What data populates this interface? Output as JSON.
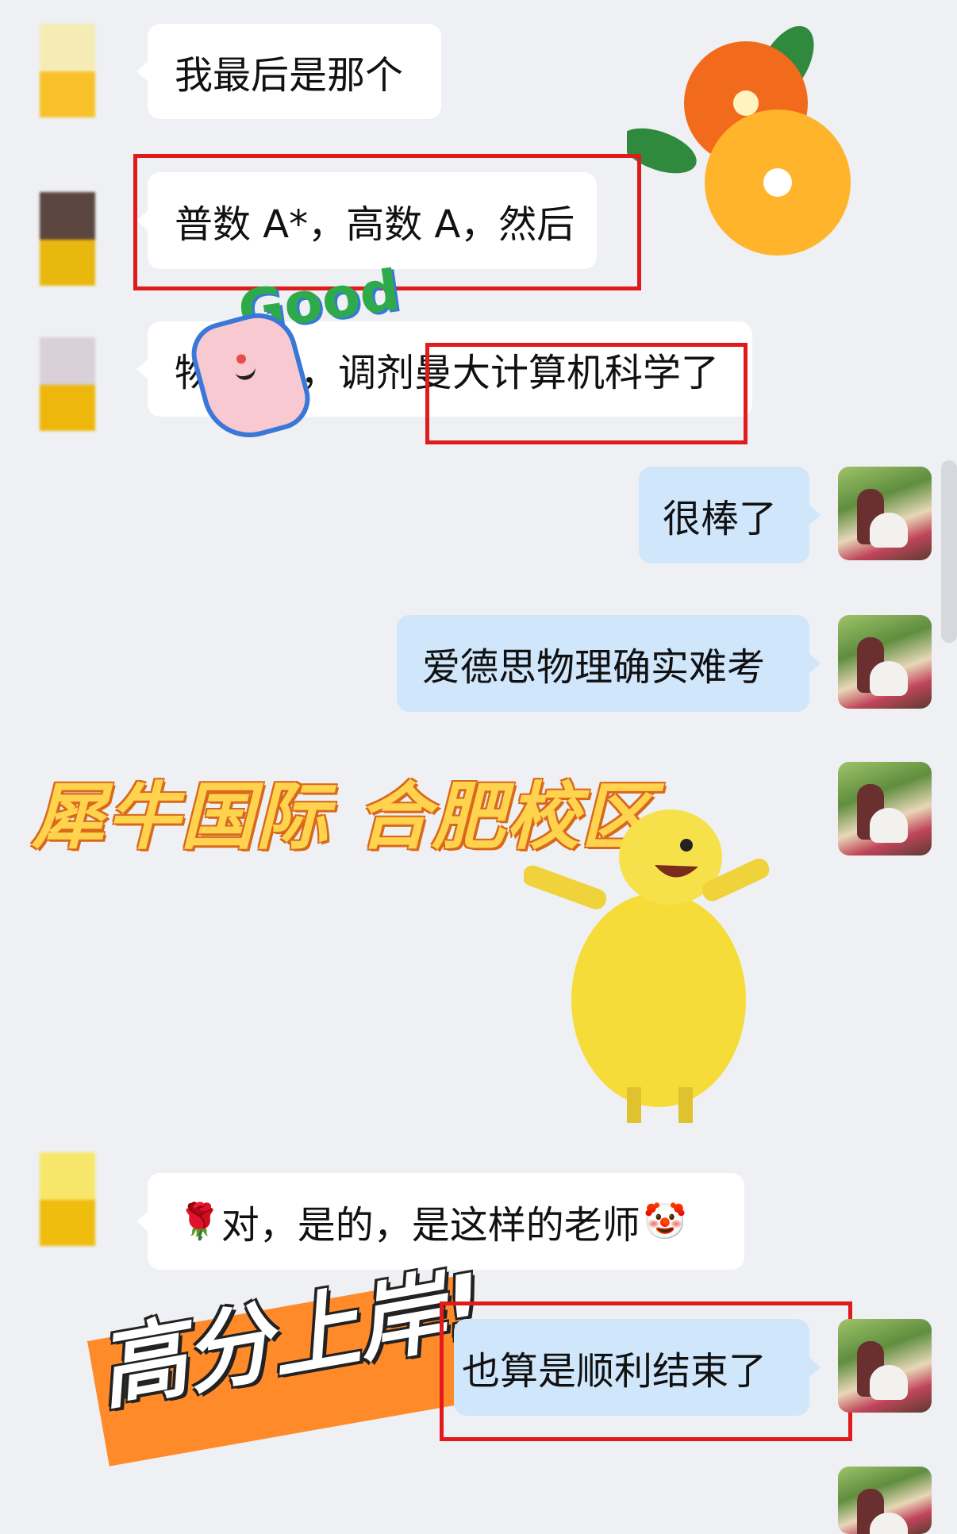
{
  "messages": {
    "m1": "我最后是那个",
    "m2": "普数 A*，高数 A，然后",
    "m3a": "物",
    "m3b": "，调剂曼大计算机科学了",
    "m4": "很棒了",
    "m5": "爱德思物理确实难考",
    "m6": "对，是的，是这样的老师",
    "m7": "也算是顺利结束了"
  },
  "overlays": {
    "good_sticker": "Good",
    "banner_campus": "犀牛国际 合肥校区",
    "banner_success": "高分上岸!"
  },
  "icons": {
    "rose": "🌹",
    "clown": "🤡"
  },
  "colors": {
    "highlight": "#e01b1b",
    "sent_bubble": "#cfe6fb",
    "received_bubble": "#ffffff"
  }
}
